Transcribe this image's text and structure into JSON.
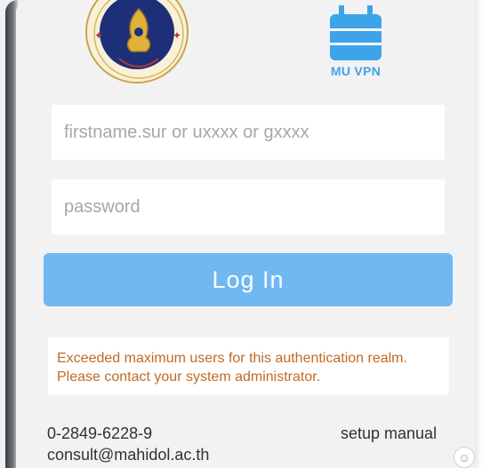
{
  "branding": {
    "vpn_label": "MU VPN"
  },
  "login": {
    "username_placeholder": "firstname.sur or uxxxx or gxxxx",
    "password_placeholder": "password",
    "login_button": "Log In"
  },
  "error": {
    "line1": "Exceeded maximum users for this authentication realm.",
    "line2": "Please contact your system administrator."
  },
  "footer": {
    "phone": "0-2849-6228-9",
    "email": "consult@mahidol.ac.th",
    "setup_manual": "setup manual"
  },
  "icons": {
    "seal": "mahidol-university-seal-icon",
    "vpn": "vpn-lock-icon",
    "emoji": "emoji-icon"
  },
  "colors": {
    "accent": "#6fb8f2",
    "vpn_blue": "#3ea4ea",
    "error_text": "#c06a24",
    "background": "#f2f2f3"
  }
}
